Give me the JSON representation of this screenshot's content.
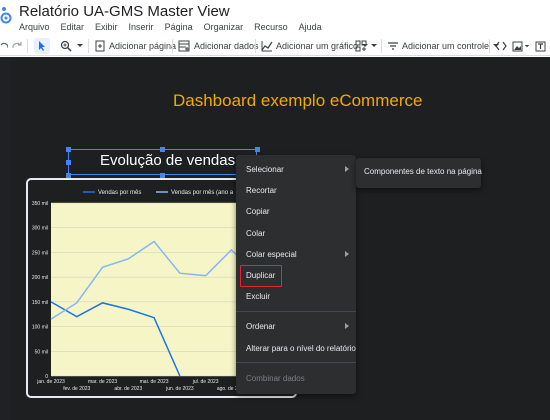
{
  "app": {
    "title": "Relatório UA-GMS Master View",
    "menu": [
      "Arquivo",
      "Editar",
      "Exibir",
      "Inserir",
      "Página",
      "Organizar",
      "Recurso",
      "Ajuda"
    ]
  },
  "toolbar": {
    "add_page": "Adicionar página",
    "add_data": "Adicionar dados",
    "add_chart": "Adicionar um gráfico",
    "add_control": "Adicionar um controle"
  },
  "canvas": {
    "dashboard_title": "Dashboard exemplo eCommerce",
    "chart_title": "Evolução de vendas"
  },
  "context_menu": {
    "items": [
      "Selecionar",
      "Recortar",
      "Copiar",
      "Colar",
      "Colar especial",
      "Duplicar",
      "Excluir",
      "Ordenar",
      "Alterar para o nível do relatório",
      "Combinar dados"
    ],
    "highlighted": "Duplicar",
    "submenu_item": "Componentes de texto na página"
  },
  "colors": {
    "accent": "#f2a900",
    "selection": "#4285f4",
    "highlight": "#e1262d",
    "series1": "#1a73e8",
    "series2": "#8ab4f8",
    "plot_background": "#f5f5c8"
  },
  "chart_data": {
    "type": "line",
    "legend_position": "top",
    "categories": [
      "jan. de 2023",
      "fev. de 2023",
      "mar. de 2023",
      "abr. de 2023",
      "mai. de 2023",
      "jun. de 2023",
      "jul. de 2023",
      "ago. de 2023",
      "set. de 2023",
      "out. de 2023"
    ],
    "x_tick_labels_row1": [
      "jan. de 2023",
      "mar. de 2023",
      "mai. de 2023",
      "jul. de 2023",
      "set. de 2023"
    ],
    "x_tick_labels_row2": [
      "fev. de 2023",
      "abr. de 2023",
      "jun. de 2023",
      "ago. de 2023",
      "out."
    ],
    "y_tick_labels": [
      "0",
      "50 mil",
      "100 mil",
      "150 mil",
      "200 mil",
      "250 mil",
      "300 mil",
      "350 mil"
    ],
    "ylim": [
      0,
      350000
    ],
    "grid": true,
    "series": [
      {
        "name": "Vendas por mês",
        "values": [
          150000,
          120000,
          148000,
          135000,
          118000,
          0,
          null,
          null,
          null,
          null
        ]
      },
      {
        "name": "Vendas por mês (ano a",
        "values": [
          115000,
          148000,
          220000,
          237000,
          272000,
          208000,
          203000,
          255000,
          205000,
          200000
        ]
      }
    ]
  }
}
